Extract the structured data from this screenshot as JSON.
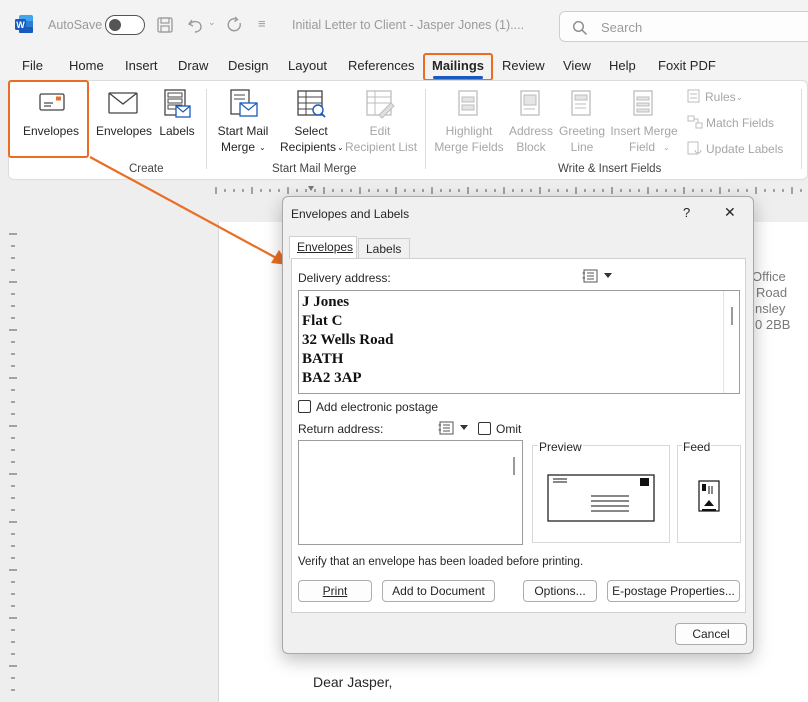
{
  "titlebar": {
    "autosave_label": "AutoSave",
    "autosave_state": "Off",
    "document_title": "Initial Letter to Client - Jasper Jones (1)....",
    "search_placeholder": "Search"
  },
  "menu": {
    "tabs": [
      "File",
      "Home",
      "Insert",
      "Draw",
      "Design",
      "Layout",
      "References",
      "Mailings",
      "Review",
      "View",
      "Help",
      "Foxit PDF"
    ],
    "active_tab": "Mailings"
  },
  "ribbon": {
    "create": {
      "group_label": "Create",
      "envelopes_label": "Envelopes",
      "labels_label": "Labels"
    },
    "start_mail_merge": {
      "group_label": "Start Mail Merge",
      "start_mail_merge_line1": "Start Mail",
      "start_mail_merge_line2": "Merge",
      "select_recipients_line1": "Select",
      "select_recipients_line2": "Recipients",
      "edit_recipient_list_line1": "Edit",
      "edit_recipient_list_line2": "Recipient List"
    },
    "write_insert": {
      "group_label": "Write & Insert Fields",
      "highlight_line1": "Highlight",
      "highlight_line2": "Merge Fields",
      "address_block_line1": "Address",
      "address_block_line2": "Block",
      "greeting_line_line1": "Greeting",
      "greeting_line_line2": "Line",
      "insert_merge_field_line1": "Insert Merge",
      "insert_merge_field_line2": "Field",
      "rules_label": "Rules",
      "match_fields_label": "Match Fields",
      "update_labels_label": "Update Labels"
    }
  },
  "document": {
    "return_address_fragments": [
      "Office",
      "Road",
      "nsley",
      "0 2BB"
    ],
    "salutation": "Dear Jasper,"
  },
  "dialog": {
    "title": "Envelopes and Labels",
    "help_label": "?",
    "close_label": "✕",
    "tabs": [
      "Envelopes",
      "Labels"
    ],
    "active_tab": "Envelopes",
    "delivery_address_label": "Delivery address:",
    "delivery_address_lines": [
      "J Jones",
      "Flat C",
      "32 Wells Road",
      "BATH",
      "BA2 3AP"
    ],
    "add_electronic_postage_label": "Add electronic postage",
    "add_electronic_postage_checked": false,
    "return_address_label": "Return address:",
    "omit_label": "Omit",
    "omit_checked": false,
    "return_address_value": "",
    "preview_label": "Preview",
    "feed_label": "Feed",
    "verify_message": "Verify that an envelope has been loaded before printing.",
    "buttons": {
      "print": "Print",
      "add_to_document": "Add to Document",
      "options": "Options...",
      "e_postage_properties": "E-postage Properties...",
      "cancel": "Cancel"
    }
  },
  "colors": {
    "callout": "#e96e23",
    "word_blue": "#185abd",
    "disabled_text": "#a6a6a6"
  }
}
